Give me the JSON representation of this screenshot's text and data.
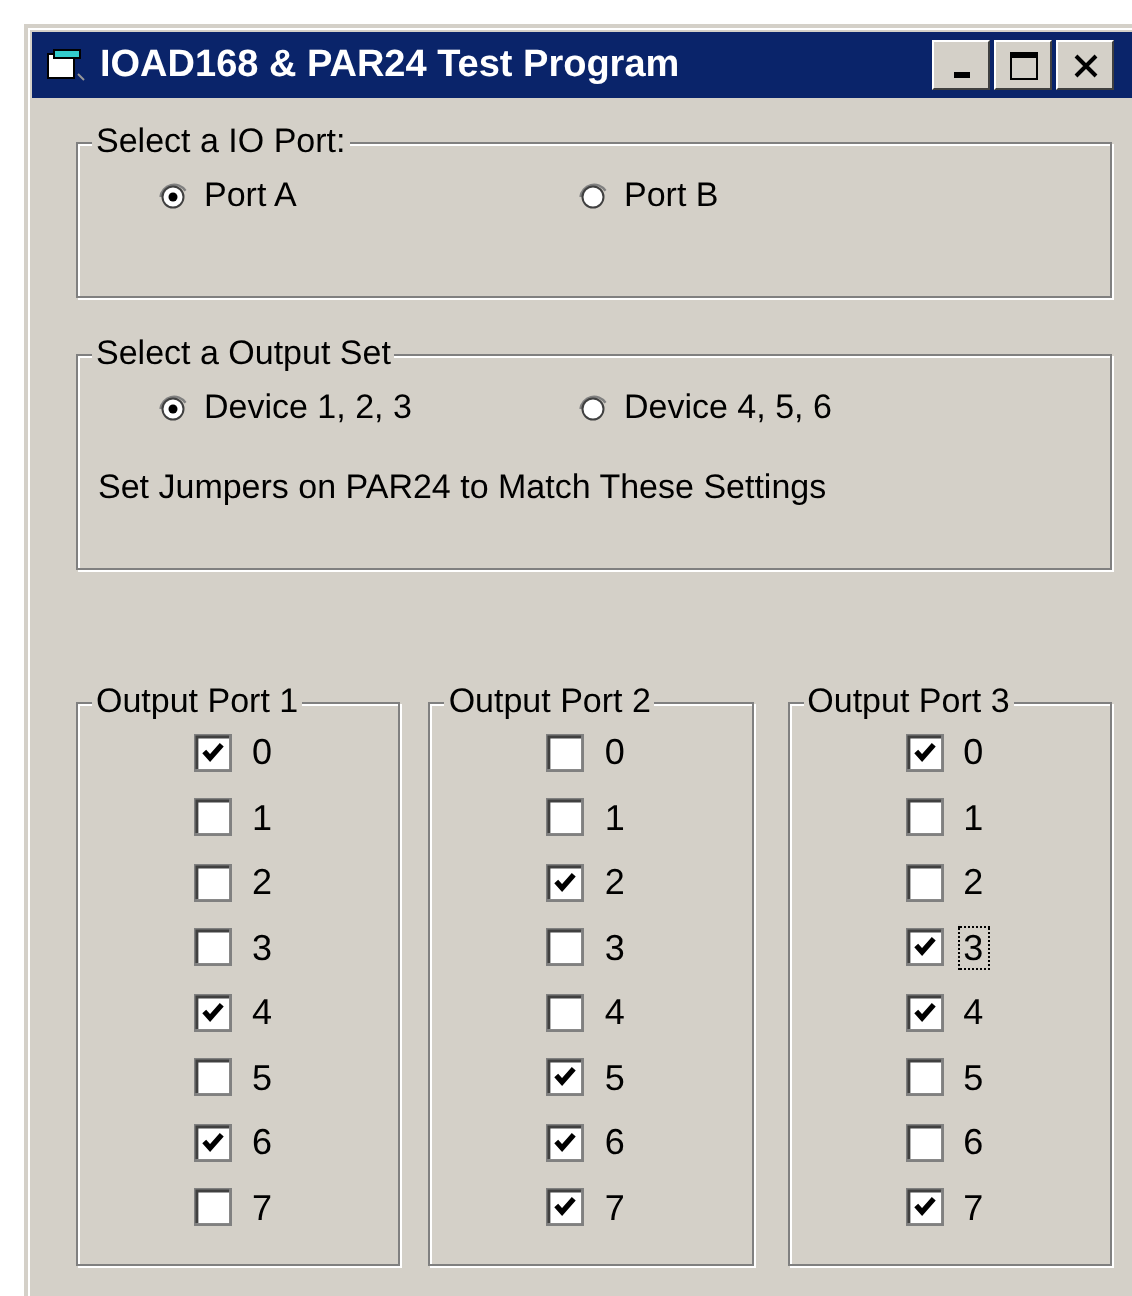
{
  "window": {
    "title": "IOAD168 & PAR24 Test Program"
  },
  "io_port": {
    "legend": "Select a IO Port:",
    "options": [
      {
        "label": "Port A",
        "selected": true
      },
      {
        "label": "Port B",
        "selected": false
      }
    ]
  },
  "output_set": {
    "legend": "Select a Output Set",
    "options": [
      {
        "label": "Device 1, 2, 3",
        "selected": true
      },
      {
        "label": "Device 4, 5, 6",
        "selected": false
      }
    ],
    "note": "Set Jumpers on PAR24 to Match These Settings"
  },
  "output_ports": [
    {
      "legend": "Output Port 1",
      "bits": [
        {
          "label": "0",
          "checked": true,
          "focused": false
        },
        {
          "label": "1",
          "checked": false,
          "focused": false
        },
        {
          "label": "2",
          "checked": false,
          "focused": false
        },
        {
          "label": "3",
          "checked": false,
          "focused": false
        },
        {
          "label": "4",
          "checked": true,
          "focused": false
        },
        {
          "label": "5",
          "checked": false,
          "focused": false
        },
        {
          "label": "6",
          "checked": true,
          "focused": false
        },
        {
          "label": "7",
          "checked": false,
          "focused": false
        }
      ]
    },
    {
      "legend": "Output Port 2",
      "bits": [
        {
          "label": "0",
          "checked": false,
          "focused": false
        },
        {
          "label": "1",
          "checked": false,
          "focused": false
        },
        {
          "label": "2",
          "checked": true,
          "focused": false
        },
        {
          "label": "3",
          "checked": false,
          "focused": false
        },
        {
          "label": "4",
          "checked": false,
          "focused": false
        },
        {
          "label": "5",
          "checked": true,
          "focused": false
        },
        {
          "label": "6",
          "checked": true,
          "focused": false
        },
        {
          "label": "7",
          "checked": true,
          "focused": false
        }
      ]
    },
    {
      "legend": "Output Port 3",
      "bits": [
        {
          "label": "0",
          "checked": true,
          "focused": false
        },
        {
          "label": "1",
          "checked": false,
          "focused": false
        },
        {
          "label": "2",
          "checked": false,
          "focused": false
        },
        {
          "label": "3",
          "checked": true,
          "focused": true
        },
        {
          "label": "4",
          "checked": true,
          "focused": false
        },
        {
          "label": "5",
          "checked": false,
          "focused": false
        },
        {
          "label": "6",
          "checked": false,
          "focused": false
        },
        {
          "label": "7",
          "checked": true,
          "focused": false
        }
      ]
    }
  ]
}
